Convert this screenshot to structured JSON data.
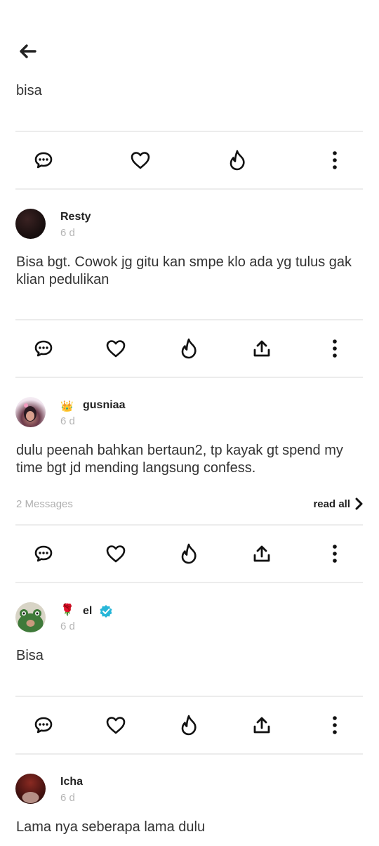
{
  "top_post": {
    "text": "bisa"
  },
  "comments": [
    {
      "author": "Resty",
      "time": "6 d",
      "text": "Bisa bgt. Cowok jg gitu kan smpe klo ada yg tulus gak klian pedulikan"
    },
    {
      "author": "gusniaa",
      "author_emoji": "👑",
      "time": "6 d",
      "text": "dulu peenah bahkan bertaun2, tp kayak gt spend my time bgt jd mending langsung confess.",
      "messages_count": "2 Messages",
      "read_all": "read all"
    },
    {
      "author": "el",
      "author_emoji": "🌹",
      "time": "6 d",
      "text": "Bisa",
      "verified": true
    },
    {
      "author": "Icha",
      "time": "6 d",
      "text": "Lama nya seberapa lama dulu"
    }
  ],
  "icons": [
    "back-arrow-icon",
    "comment-icon",
    "heart-icon",
    "flame-icon",
    "share-icon",
    "more-vertical-icon",
    "chevron-right-icon",
    "verified-badge-icon"
  ],
  "colors": {
    "text": "#2b2b2b",
    "muted": "#b5b5b5",
    "divider": "#ececec",
    "verified": "#27b6d8"
  }
}
